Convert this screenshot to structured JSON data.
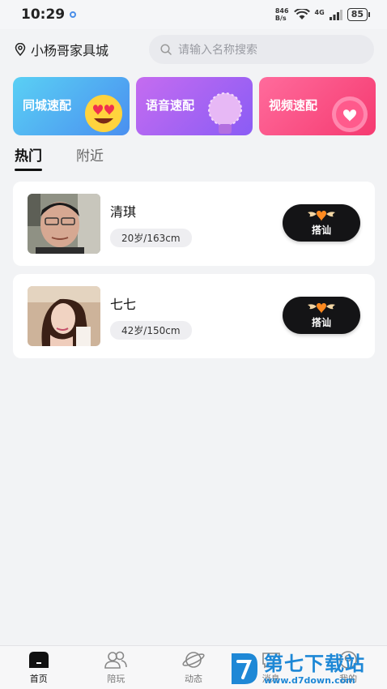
{
  "status_bar": {
    "time": "10:29",
    "net_speed_value": "846",
    "net_speed_unit": "B/s",
    "network": "4G",
    "battery": "85"
  },
  "header": {
    "location": "小杨哥家具城",
    "search_placeholder": "请输入名称搜索"
  },
  "quick_match": [
    {
      "label": "同城速配",
      "icon": "heart-eyes-emoji-icon",
      "color": "#4a8ff0"
    },
    {
      "label": "语音速配",
      "icon": "microphone-icon",
      "color": "#8a5cf5"
    },
    {
      "label": "视频速配",
      "icon": "heart-bubble-icon",
      "color": "#f53a70"
    }
  ],
  "tabs": [
    {
      "label": "热门",
      "active": true
    },
    {
      "label": "附近",
      "active": false
    }
  ],
  "users": [
    {
      "name": "清琪",
      "meta": "20岁/163cm",
      "button": "搭讪"
    },
    {
      "name": "七七",
      "meta": "42岁/150cm",
      "button": "搭讪"
    }
  ],
  "bottom_nav": [
    {
      "label": "首页",
      "icon": "home-icon",
      "active": true
    },
    {
      "label": "陪玩",
      "icon": "users-icon",
      "active": false
    },
    {
      "label": "动态",
      "icon": "planet-icon",
      "active": false
    },
    {
      "label": "消息",
      "icon": "message-icon",
      "active": false
    },
    {
      "label": "我的",
      "icon": "profile-icon",
      "active": false
    }
  ],
  "watermark": {
    "title": "第七下载站",
    "url": "www.d7down.com"
  }
}
